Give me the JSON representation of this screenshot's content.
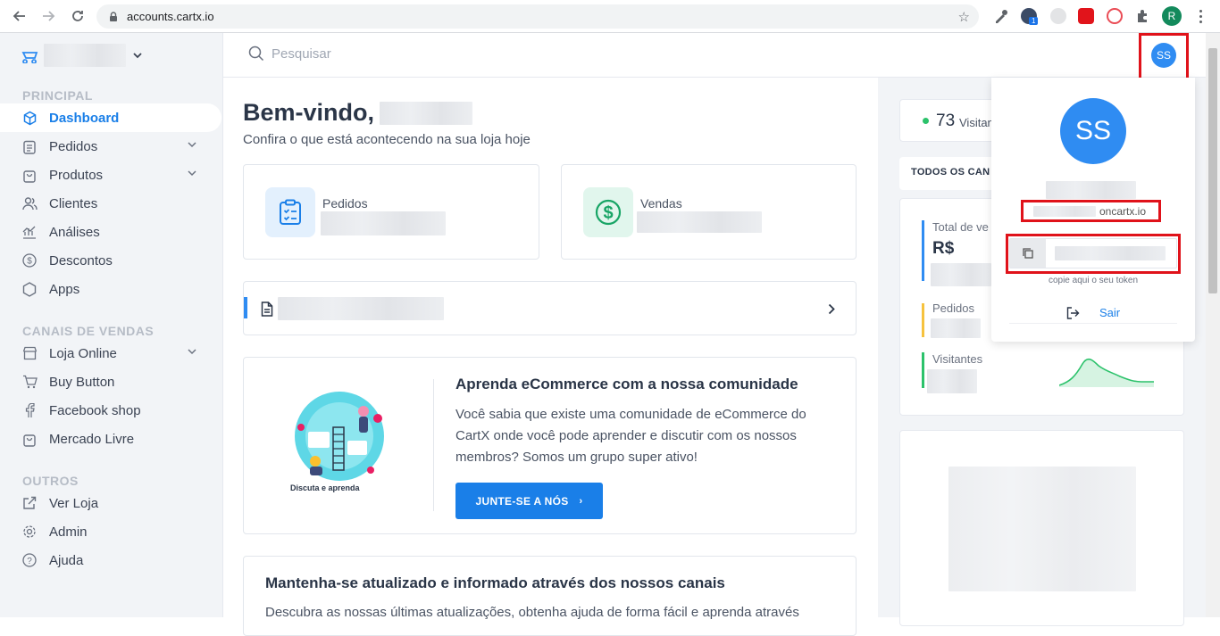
{
  "browser": {
    "url": "accounts.cartx.io",
    "profile_initial": "R",
    "ext_badge": "1"
  },
  "sidebar": {
    "sections": {
      "principal": "PRINCIPAL",
      "canais": "CANAIS DE VENDAS",
      "outros": "OUTROS"
    },
    "items": [
      {
        "label": "Dashboard"
      },
      {
        "label": "Pedidos"
      },
      {
        "label": "Produtos"
      },
      {
        "label": "Clientes"
      },
      {
        "label": "Análises"
      },
      {
        "label": "Descontos"
      },
      {
        "label": "Apps"
      },
      {
        "label": "Loja Online"
      },
      {
        "label": "Buy Button"
      },
      {
        "label": "Facebook shop"
      },
      {
        "label": "Mercado Livre"
      },
      {
        "label": "Ver Loja"
      },
      {
        "label": "Admin"
      },
      {
        "label": "Ajuda"
      }
    ]
  },
  "header": {
    "search_placeholder": "Pesquisar",
    "avatar_initials": "SS"
  },
  "main": {
    "welcome": "Bem-vindo,",
    "subtitle": "Confira o que está acontecendo na sua loja hoje",
    "stats": {
      "orders_label": "Pedidos",
      "sales_label": "Vendas"
    },
    "community": {
      "title": "Aprenda eCommerce com a nossa comunidade",
      "text": "Você sabia que existe uma comunidade de eCommerce do CartX onde você pode aprender e discutir com os nossos membros? Somos um grupo super ativo!",
      "button": "JUNTE-SE A NÓS",
      "caption": "Discuta e aprenda"
    },
    "updates": {
      "title": "Mantenha-se atualizado e informado através dos nossos canais",
      "text": "Descubra as nossas últimas atualizações, obtenha ajuda de forma fácil e aprenda através"
    }
  },
  "right": {
    "visitors_count": "73",
    "visitors_label": "Visitan",
    "channels_label": "TODOS OS CAN",
    "total_label": "Total de ve",
    "currency": "R$",
    "orders_label": "Pedidos",
    "visitors_metric_label": "Visitantes"
  },
  "dropdown": {
    "initials": "SS",
    "email": "oncartx.io",
    "token_hint": "copie aqui o seu token",
    "logout": "Sair"
  },
  "colors": {
    "accent": "#1a7fe8",
    "highlight": "#e0121a",
    "success": "#2cc26b"
  }
}
